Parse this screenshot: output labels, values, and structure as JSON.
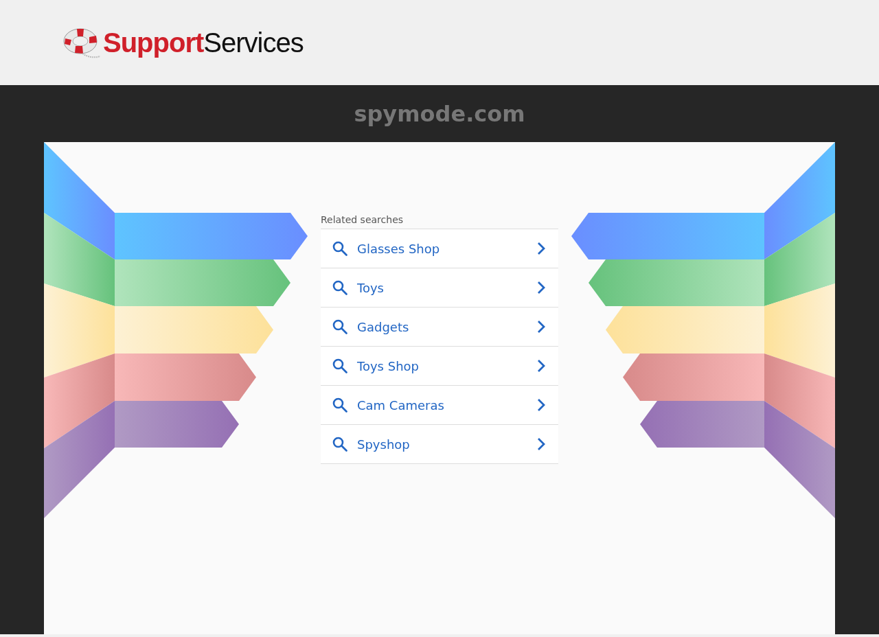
{
  "header": {
    "logo": {
      "primary": "Support",
      "secondary": "Services"
    }
  },
  "domain": "spymode.com",
  "related_searches": {
    "heading": "Related searches",
    "items": [
      {
        "label": "Glasses Shop"
      },
      {
        "label": "Toys"
      },
      {
        "label": "Gadgets"
      },
      {
        "label": "Toys Shop"
      },
      {
        "label": "Cam Cameras"
      },
      {
        "label": "Spyshop"
      }
    ]
  }
}
